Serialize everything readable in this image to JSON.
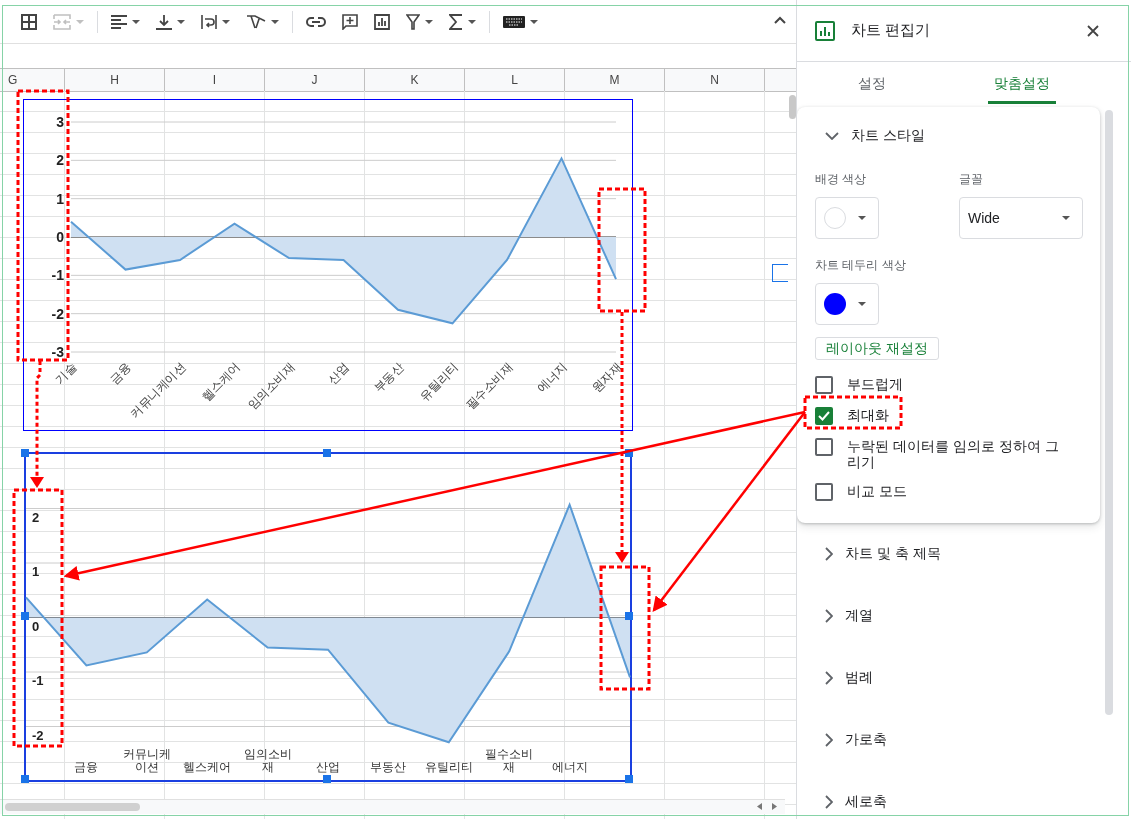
{
  "toolbar": [
    {
      "kind": "borders",
      "disabled": false,
      "menu": false
    },
    {
      "kind": "merge",
      "disabled": true,
      "menu": true
    },
    {
      "kind": "separator"
    },
    {
      "kind": "align",
      "disabled": false,
      "menu": true
    },
    {
      "kind": "valign",
      "disabled": false,
      "menu": true
    },
    {
      "kind": "wrap",
      "disabled": false,
      "menu": true
    },
    {
      "kind": "rotate",
      "disabled": false,
      "menu": true
    },
    {
      "kind": "separator"
    },
    {
      "kind": "link",
      "disabled": false,
      "menu": false
    },
    {
      "kind": "comment",
      "disabled": false,
      "menu": false
    },
    {
      "kind": "chart",
      "disabled": false,
      "menu": false
    },
    {
      "kind": "filter",
      "disabled": false,
      "menu": true
    },
    {
      "kind": "functions",
      "disabled": false,
      "menu": true
    },
    {
      "kind": "separator"
    },
    {
      "kind": "keyboard",
      "disabled": false,
      "menu": true
    }
  ],
  "column_headers": [
    "G",
    "H",
    "I",
    "J",
    "K",
    "L",
    "M",
    "N"
  ],
  "charts": [
    {
      "selected": false,
      "chart_data": {
        "type": "area",
        "categories": [
          "기술",
          "금융",
          "커뮤니케이션",
          "헬스케어",
          "임의소비재",
          "산업",
          "부동산",
          "유틸리티",
          "필수소비재",
          "에너지",
          "원자재"
        ],
        "values": [
          0.4,
          -0.85,
          -0.6,
          0.35,
          -0.55,
          -0.6,
          -1.9,
          -2.25,
          -0.6,
          2.05,
          -1.1
        ],
        "grid": true,
        "ylim": [
          -3,
          3
        ],
        "yticks": [
          -3,
          -2,
          -1,
          0,
          1,
          2,
          3
        ]
      }
    },
    {
      "selected": true,
      "chart_data": {
        "type": "area",
        "categories": [
          null,
          "금융",
          "커뮤니케이션",
          "헬스케어",
          "임의소비재",
          "산업",
          "부동산",
          "유틸리티",
          "필수소비재",
          "에너지",
          null
        ],
        "values": [
          0.37,
          -0.88,
          -0.64,
          0.33,
          -0.55,
          -0.59,
          -1.93,
          -2.29,
          -0.62,
          2.07,
          -1.1
        ],
        "grid": true,
        "ylim": [
          -3,
          3
        ],
        "yticks": [
          -2,
          -1,
          0,
          1,
          2
        ]
      }
    }
  ],
  "panel": {
    "title": "차트 편집기",
    "tabs": [
      {
        "label": "설정",
        "selected": false
      },
      {
        "label": "맞춤설정",
        "selected": true
      }
    ],
    "sections": [
      {
        "title": "차트 스타일",
        "expanded": true
      },
      {
        "title": "차트 및 축 제목",
        "expanded": false
      },
      {
        "title": "계열",
        "expanded": false
      },
      {
        "title": "범례",
        "expanded": false
      },
      {
        "title": "가로축",
        "expanded": false
      },
      {
        "title": "세로축",
        "expanded": false
      }
    ],
    "chart_style": {
      "background_color": {
        "label": "배경 색상",
        "color": "#ffffff"
      },
      "font": {
        "label": "글꼴",
        "value": "Wide"
      },
      "border_color": {
        "label": "차트 테두리 색상",
        "color": "#0000ff"
      },
      "reset_button": "레이아웃 재설정",
      "options": [
        {
          "label": "부드럽게",
          "checked": false
        },
        {
          "label": "최대화",
          "checked": true
        },
        {
          "label": "누락된 데이터를 임의로 정하여 그리기",
          "checked": false
        },
        {
          "label": "비교 모드",
          "checked": false
        }
      ]
    }
  }
}
